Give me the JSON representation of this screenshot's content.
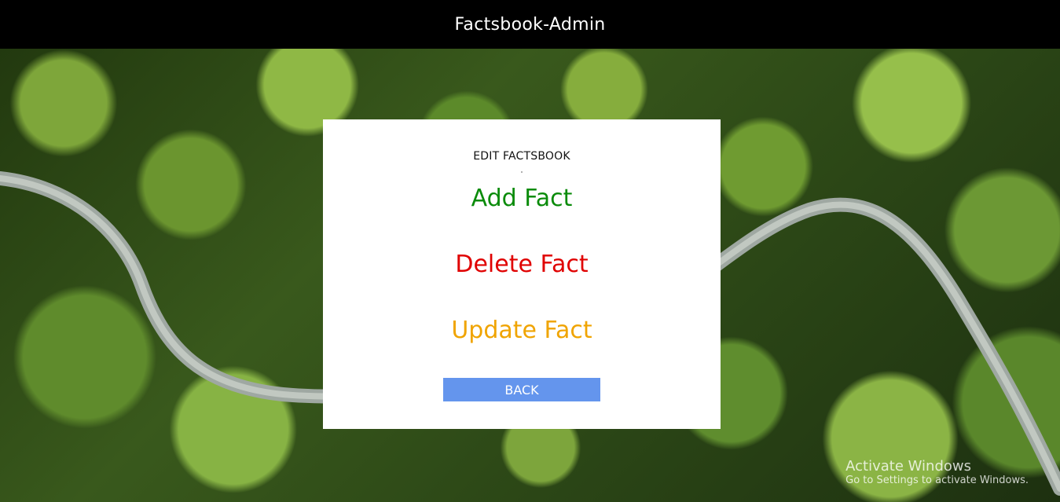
{
  "header": {
    "title": "Factsbook-Admin"
  },
  "card": {
    "title": "EDIT FACTSBOOK",
    "actions": [
      {
        "label": "Add Fact",
        "color": "#0a8b0a"
      },
      {
        "label": "Delete Fact",
        "color": "#e00000"
      },
      {
        "label": "Update Fact",
        "color": "#f0a400"
      }
    ],
    "back_label": "BACK",
    "back_color": "#6495ed"
  },
  "watermark": {
    "title": "Activate Windows",
    "subtitle": "Go to Settings to activate Windows."
  },
  "colors": {
    "header_bg": "#000000",
    "card_bg": "#ffffff"
  }
}
